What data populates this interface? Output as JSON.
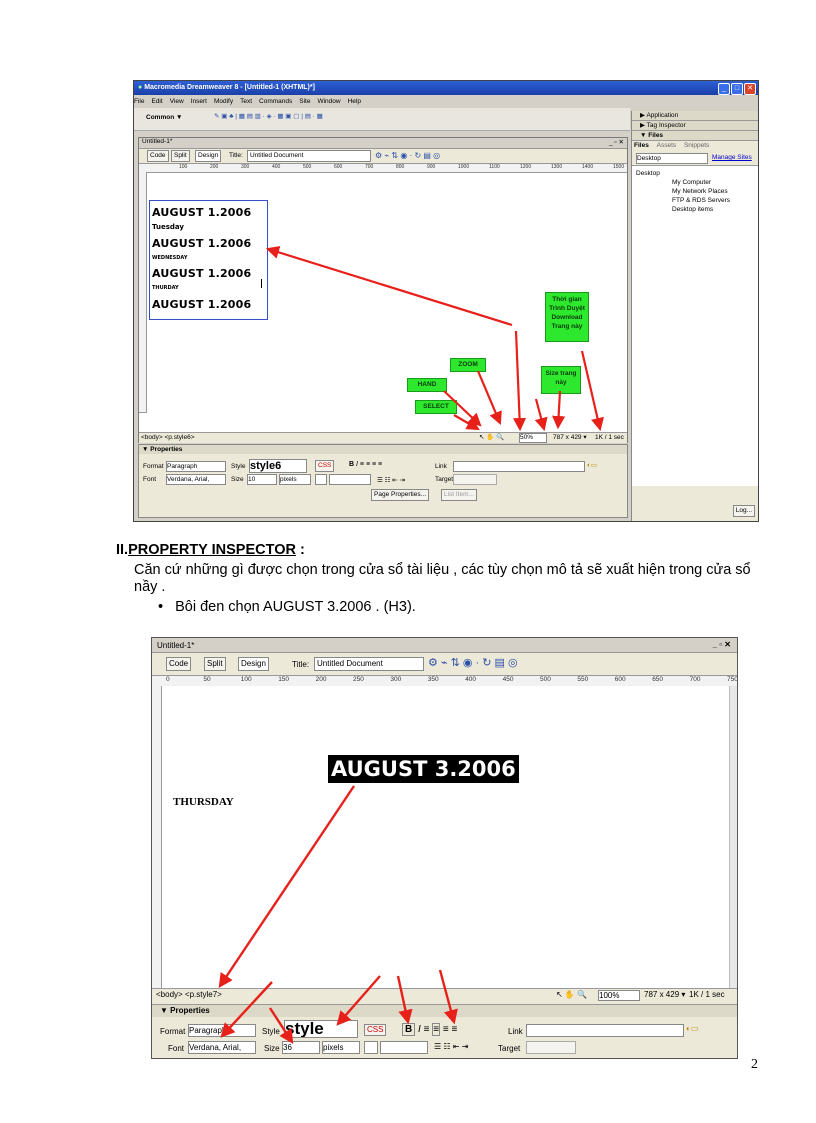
{
  "screenshot1": {
    "title": "Macromedia Dreamweaver 8 - [Untitled-1 (XHTML)*]",
    "menu": [
      "File",
      "Edit",
      "View",
      "Insert",
      "Modify",
      "Text",
      "Commands",
      "Site",
      "Window",
      "Help"
    ],
    "insert_category": "Common ▼",
    "doc_tab": "Untitled-1*",
    "view_buttons": [
      "Code",
      "Split",
      "Design"
    ],
    "title_label": "Title:",
    "title_value": "Untitled Document",
    "ruler_ticks": [
      "100",
      "200",
      "300",
      "400",
      "500",
      "600",
      "700",
      "800",
      "900",
      "1000",
      "1100",
      "1200",
      "1300",
      "1400",
      "1500"
    ],
    "content": {
      "dates": [
        "AUGUST 1.2006",
        "AUGUST 1.2006",
        "AUGUST 1.2006",
        "AUGUST 1.2006"
      ],
      "days": [
        "Tuesday",
        "WEDNESDAY",
        "THURDAY"
      ]
    },
    "annotations": {
      "timing": "Thời gian Trình Duyệt Download Trang này",
      "zoom": "ZOOM",
      "hand": "HAND",
      "select": "SELECT",
      "page_size": "Size trang này"
    },
    "status": {
      "tag": "<body> <p.style6>",
      "zoom": "50%",
      "size": "787 x 429 ▾",
      "time": "1K / 1 sec"
    },
    "properties": {
      "header": "▼ Properties",
      "format_label": "Format",
      "format_value": "Paragraph",
      "style_label": "Style",
      "style_value": "style6",
      "css_button": "CSS",
      "link_label": "Link",
      "font_label": "Font",
      "font_value": "Verdana, Arial,",
      "size_label": "Size",
      "size_value": "10",
      "unit_value": "pixels",
      "target_label": "Target",
      "page_props": "Page Properties...",
      "list_item": "List Item..."
    },
    "right_panel": {
      "application": "▶ Application",
      "tag_inspector": "▶ Tag Inspector",
      "files_header": "▼ Files",
      "tabs": [
        "Files",
        "Assets",
        "Snippets"
      ],
      "location": "Desktop",
      "manage_sites": "Manage Sites",
      "tree_root": "Desktop",
      "tree": [
        "My Computer",
        "My Network Places",
        "FTP & RDS Servers",
        "Desktop items"
      ],
      "log": "Log..."
    }
  },
  "section": {
    "heading_num": "II.",
    "heading_title": "PROPERTY INSPECTOR",
    "heading_tail": " :",
    "paragraph": "Căn cứ những gì được chọn trong cửa sổ tài liệu , các tùy chọn mô tả sẽ xuất hiện trong cửa sổ nầy .",
    "bullet": "Bôi đen chọn AUGUST 3.2006 . (H3)."
  },
  "screenshot2": {
    "doc_tab": "Untitled-1*",
    "view_buttons": [
      "Code",
      "Split",
      "Design"
    ],
    "title_label": "Title:",
    "title_value": "Untitled Document",
    "ruler_ticks": [
      "0",
      "50",
      "100",
      "150",
      "200",
      "250",
      "300",
      "350",
      "400",
      "450",
      "500",
      "550",
      "600",
      "650",
      "700",
      "750"
    ],
    "selected_text": "AUGUST 3.2006",
    "day_text": "THURSDAY",
    "status": {
      "tag": "<body> <p.style7>",
      "zoom": "100%",
      "size": "787 x 429 ▾",
      "time": "1K / 1 sec"
    },
    "properties": {
      "header": "▼ Properties",
      "format_label": "Format",
      "format_value": "Paragraph",
      "style_label": "Style",
      "style_value": "style",
      "css_button": "CSS",
      "link_label": "Link",
      "font_label": "Font",
      "font_value": "Verdana, Arial,",
      "size_label": "Size",
      "size_value": "36",
      "unit_value": "pixels",
      "target_label": "Target"
    }
  },
  "page_number": "2",
  "colors": {
    "arrow": "#e8201a",
    "label_green": "#2ee82e",
    "title_blue": "#1f4fc4"
  }
}
